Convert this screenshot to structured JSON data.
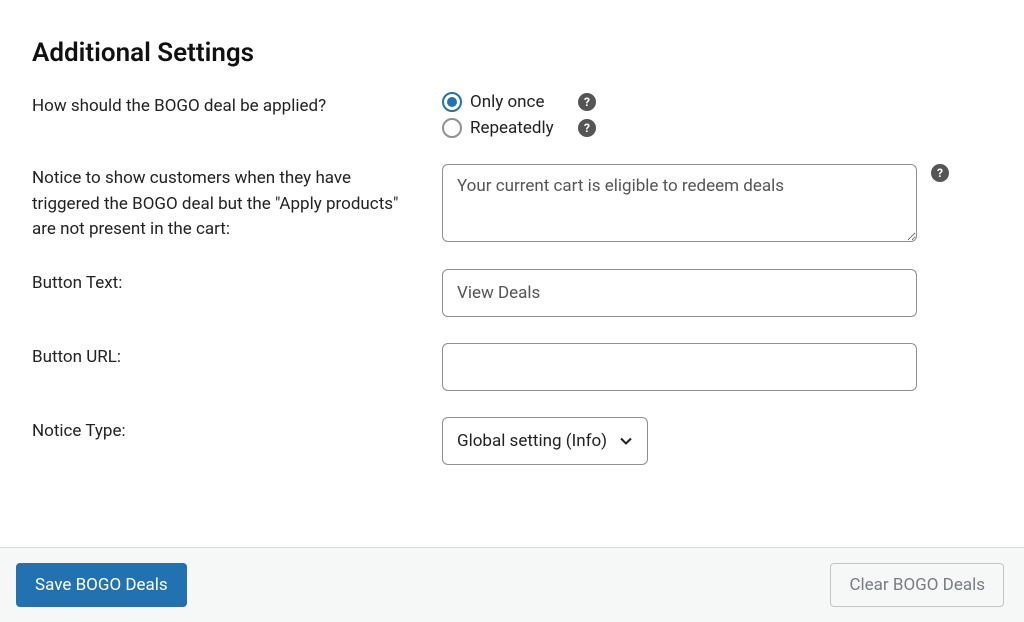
{
  "section_title": "Additional Settings",
  "apply": {
    "label": "How should the BOGO deal be applied?",
    "option_once": "Only once",
    "option_repeatedly": "Repeatedly",
    "selected": "once"
  },
  "notice": {
    "label": "Notice to show customers when they have triggered the BOGO deal but the \"Apply products\" are not present in the cart:",
    "value": "Your current cart is eligible to redeem deals"
  },
  "button_text": {
    "label": "Button Text:",
    "value": "View Deals"
  },
  "button_url": {
    "label": "Button URL:",
    "value": ""
  },
  "notice_type": {
    "label": "Notice Type:",
    "selected": "Global setting (Info)"
  },
  "footer": {
    "save": "Save BOGO Deals",
    "clear": "Clear BOGO Deals"
  }
}
